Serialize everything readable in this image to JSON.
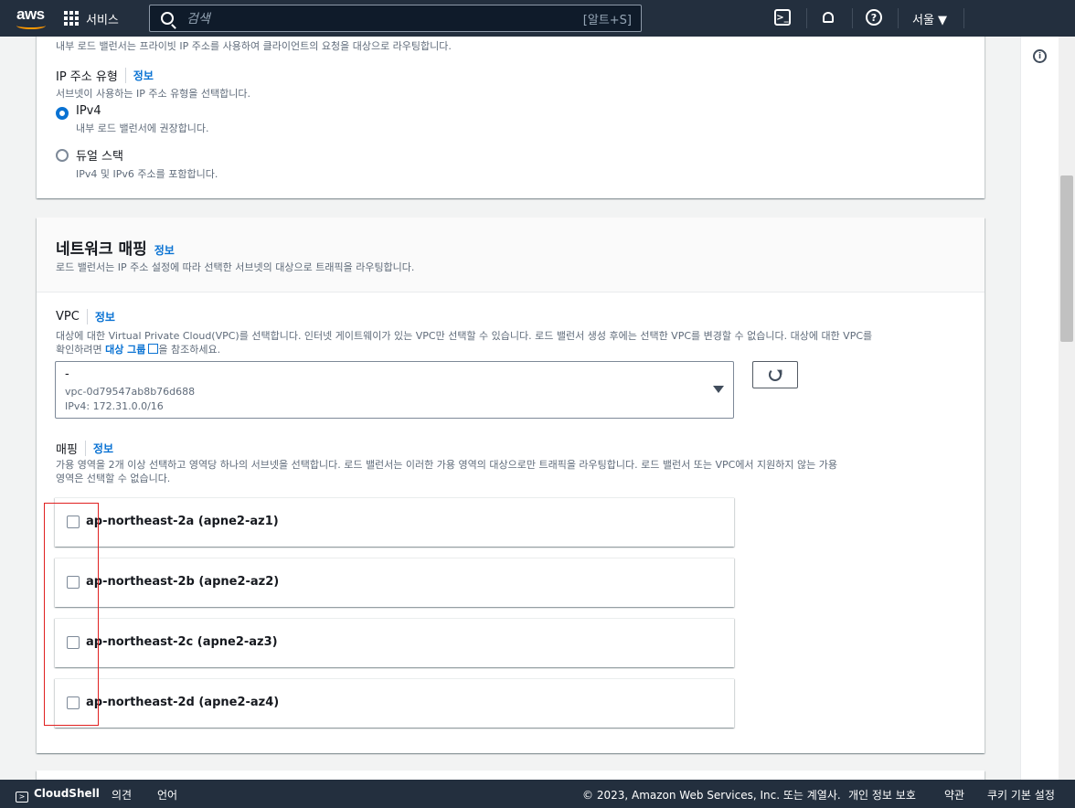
{
  "topnav": {
    "logo": "aws",
    "services_label": "서비스",
    "search_placeholder": "검색",
    "search_shortcut": "[알트+S]",
    "region_label": "서울 ▼",
    "cloudshell_icon": ">_",
    "help_icon": "?"
  },
  "ip_section": {
    "cut_text": "내부 로드 밸런서는 프라이빗 IP 주소를 사용하여 클라이언트의 요청을 대상으로 라우팅합니다.",
    "label": "IP 주소 유형",
    "info": "정보",
    "desc": "서브넷이 사용하는 IP 주소 유형을 선택합니다.",
    "options": [
      {
        "label": "IPv4",
        "desc": "내부 로드 밸런서에 권장합니다.",
        "checked": true
      },
      {
        "label": "듀얼 스택",
        "desc": "IPv4 및 IPv6 주소를 포함합니다.",
        "checked": false
      }
    ]
  },
  "network_mapping": {
    "title": "네트워크 매핑",
    "info": "정보",
    "desc": "로드 밸런서는 IP 주소 설정에 따라 선택한 서브넷의 대상으로 트래픽을 라우팅합니다.",
    "vpc": {
      "label": "VPC",
      "info": "정보",
      "desc_line1": "대상에 대한 Virtual Private Cloud(VPC)를 선택합니다. 인터넷 게이트웨이가 있는 VPC만 선택할 수 있습니다. 로드 밸런서 생성 후에는 선택한 VPC를 변경할 수 없습니다. 대상에 대한 VPC를",
      "desc_line2_pre": "확인하려면",
      "desc_link": "대상 그룹",
      "desc_line2_post": "을 참조하세요.",
      "selected_name": "-",
      "selected_id": "vpc-0d79547ab8b76d688",
      "selected_cidr": "IPv4: 172.31.0.0/16"
    },
    "mapping": {
      "label": "매핑",
      "info": "정보",
      "desc_line1": "가용 영역을 2개 이상 선택하고 영역당 하나의 서브넷을 선택합니다. 로드 밸런서는 이러한 가용 영역의 대상으로만 트래픽을 라우팅합니다. 로드 밸런서 또는 VPC에서 지원하지 않는 가용",
      "desc_line2": "영역은 선택할 수 없습니다.",
      "zones": [
        {
          "label": "ap-northeast-2a (apne2-az1)",
          "checked": false
        },
        {
          "label": "ap-northeast-2b (apne2-az2)",
          "checked": false
        },
        {
          "label": "ap-northeast-2c (apne2-az3)",
          "checked": false
        },
        {
          "label": "ap-northeast-2d (apne2-az4)",
          "checked": false
        }
      ]
    }
  },
  "rail": {
    "info_icon": "i"
  },
  "footer": {
    "cloudshell": "CloudShell",
    "feedback": "의견",
    "language": "언어",
    "copyright": "© 2023, Amazon Web Services, Inc. 또는 계열사.",
    "privacy": "개인 정보 보호",
    "terms": "약관",
    "cookies": "쿠키 기본 설정"
  },
  "colors": {
    "nav_bg": "#232f3e",
    "link": "#0972d3",
    "highlight": "#e02020"
  }
}
